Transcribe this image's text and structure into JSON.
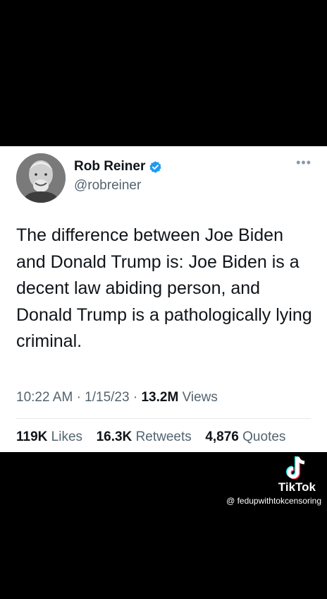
{
  "tweet": {
    "author_name": "Rob Reiner",
    "handle": "@robreiner",
    "more_icon": "more-icon",
    "text": "The difference between Joe Biden and Donald Trump is: Joe Biden is a decent law abiding person, and Donald Trump is a pathologically lying criminal.",
    "time": "10:22 AM",
    "date": "1/15/23",
    "views_count": "13.2M",
    "views_label": "Views",
    "likes_count": "119K",
    "likes_label": "Likes",
    "retweets_count": "16.3K",
    "retweets_label": "Retweets",
    "quotes_count": "4,876",
    "quotes_label": "Quotes",
    "verified_color": "#1d9bf0"
  },
  "tiktok": {
    "brand": "TikTok",
    "username": "@ fedupwithtokcensoring"
  }
}
